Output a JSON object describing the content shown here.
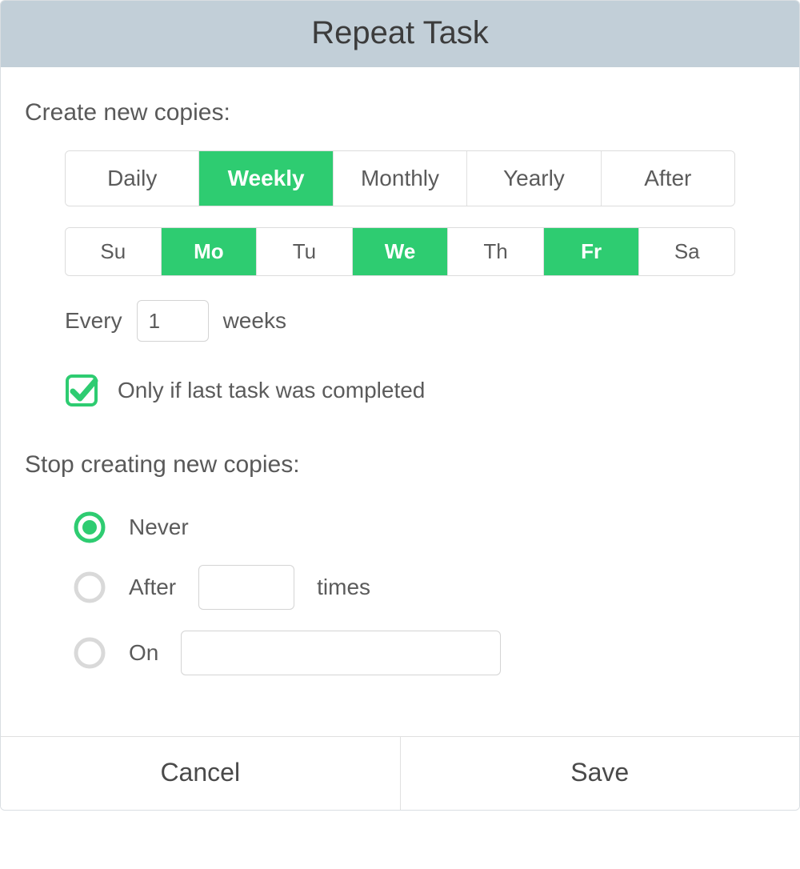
{
  "header": {
    "title": "Repeat Task"
  },
  "create": {
    "label": "Create new copies:",
    "frequency": {
      "options": [
        "Daily",
        "Weekly",
        "Monthly",
        "Yearly",
        "After"
      ],
      "selected": "Weekly"
    },
    "days": {
      "options": [
        "Su",
        "Mo",
        "Tu",
        "We",
        "Th",
        "Fr",
        "Sa"
      ],
      "selected": [
        "Mo",
        "We",
        "Fr"
      ]
    },
    "every": {
      "prefix": "Every",
      "value": "1",
      "suffix": "weeks"
    },
    "only_if": {
      "checked": true,
      "label": "Only if last task was completed"
    }
  },
  "stop": {
    "label": "Stop creating new copies:",
    "selected": "never",
    "never_label": "Never",
    "after_prefix": "After",
    "after_value": "",
    "after_suffix": "times",
    "on_label": "On",
    "on_value": ""
  },
  "footer": {
    "cancel": "Cancel",
    "save": "Save"
  },
  "colors": {
    "accent": "#2ecc71"
  }
}
